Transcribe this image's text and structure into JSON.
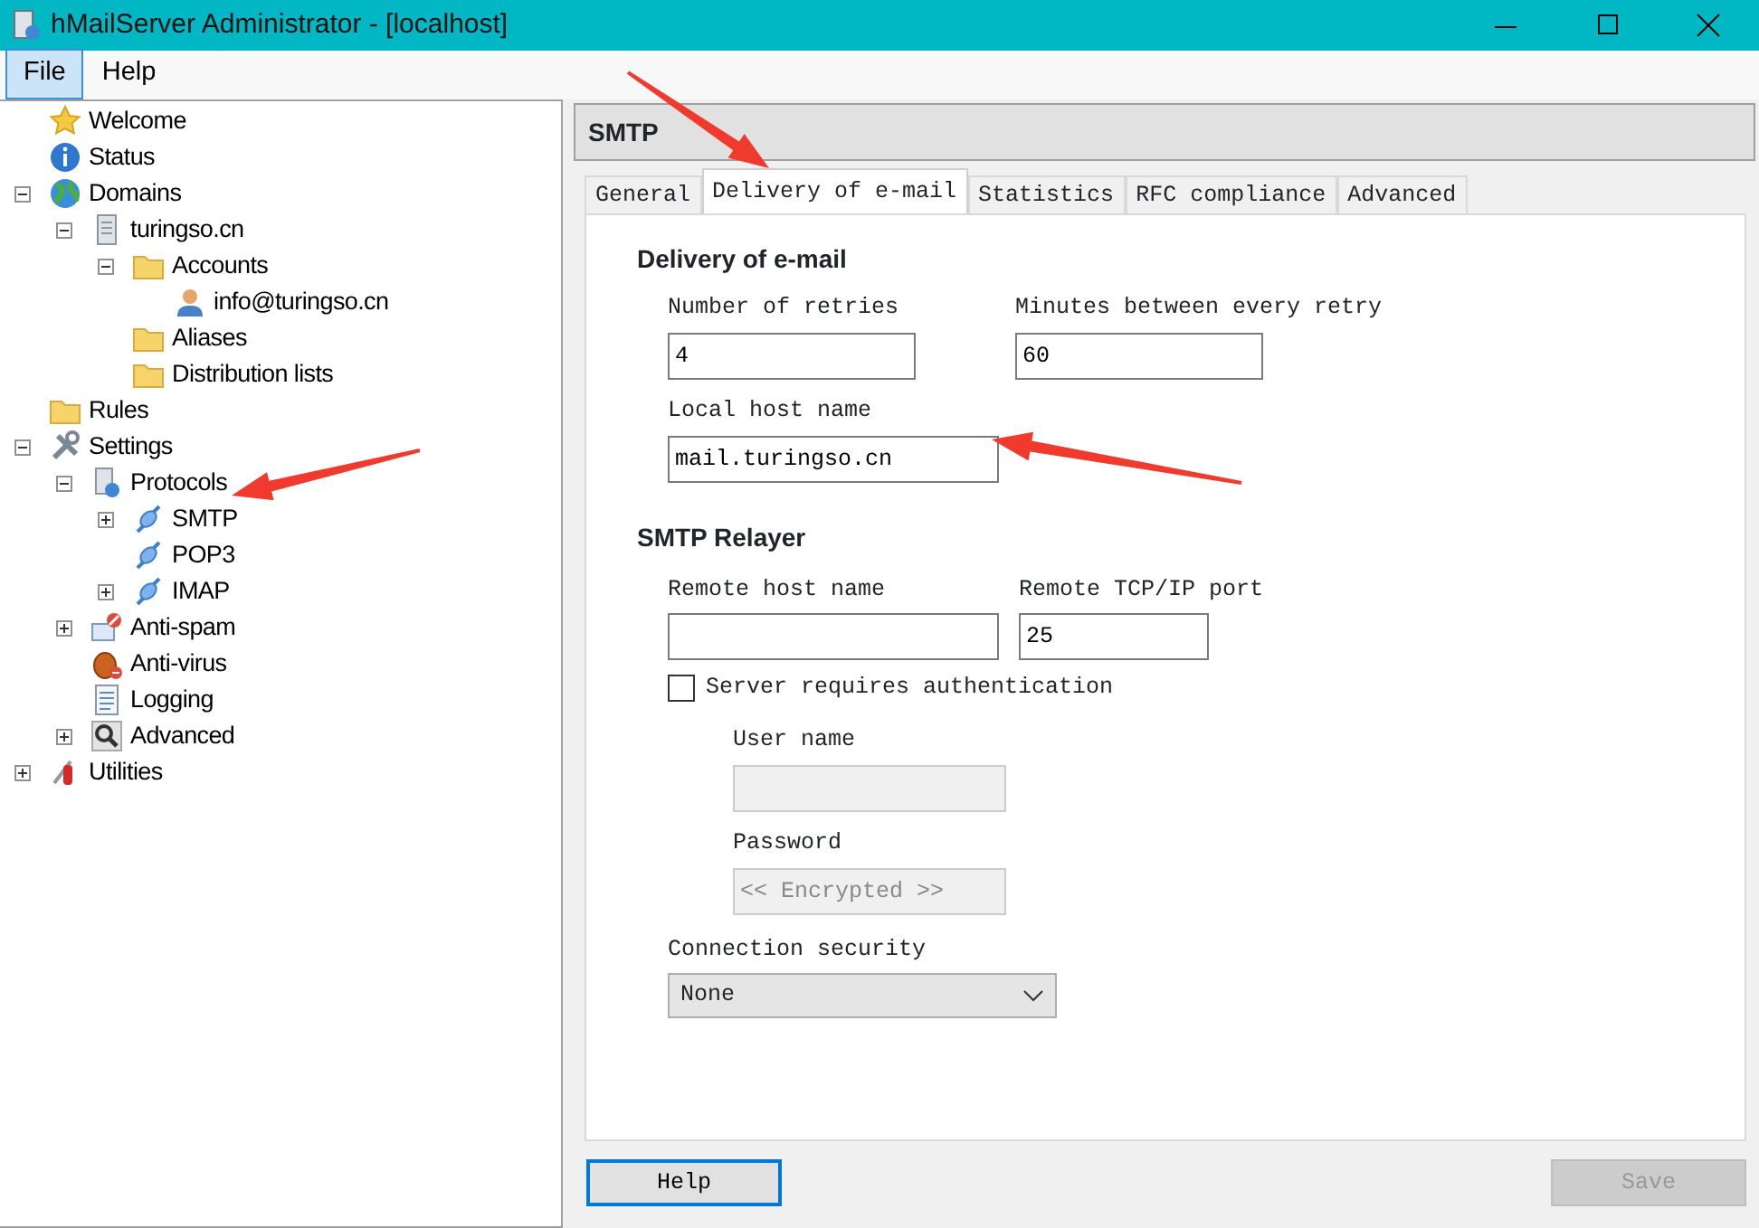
{
  "window": {
    "title": "hMailServer Administrator - [localhost]"
  },
  "menu": [
    {
      "label": "File",
      "selected": true
    },
    {
      "label": "Help",
      "selected": false
    }
  ],
  "tree": [
    {
      "label": "Welcome",
      "kind": "star"
    },
    {
      "label": "Status",
      "kind": "info"
    },
    {
      "label": "Domains",
      "kind": "globe",
      "expanded": true,
      "children": [
        {
          "label": "turingso.cn",
          "kind": "server",
          "expanded": true,
          "children": [
            {
              "label": "Accounts",
              "kind": "folder",
              "expanded": true,
              "children": [
                {
                  "label": "info@turingso.cn",
                  "kind": "user"
                }
              ]
            },
            {
              "label": "Aliases",
              "kind": "folder"
            },
            {
              "label": "Distribution lists",
              "kind": "folder"
            }
          ]
        }
      ]
    },
    {
      "label": "Rules",
      "kind": "folder"
    },
    {
      "label": "Settings",
      "kind": "tools",
      "expanded": true,
      "children": [
        {
          "label": "Protocols",
          "kind": "protocols",
          "expanded": true,
          "children": [
            {
              "label": "SMTP",
              "kind": "plug",
              "expanded": false
            },
            {
              "label": "POP3",
              "kind": "plug"
            },
            {
              "label": "IMAP",
              "kind": "plug",
              "expanded": false
            }
          ]
        },
        {
          "label": "Anti-spam",
          "kind": "antispam",
          "expanded": false
        },
        {
          "label": "Anti-virus",
          "kind": "antivirus"
        },
        {
          "label": "Logging",
          "kind": "log"
        },
        {
          "label": "Advanced",
          "kind": "magnifier",
          "expanded": false
        }
      ]
    },
    {
      "label": "Utilities",
      "kind": "knife",
      "expanded": false
    }
  ],
  "panel": {
    "title": "SMTP"
  },
  "tabs": [
    {
      "label": "General",
      "selected": false
    },
    {
      "label": "Delivery of e-mail",
      "selected": true
    },
    {
      "label": "Statistics",
      "selected": false
    },
    {
      "label": "RFC compliance",
      "selected": false
    },
    {
      "label": "Advanced",
      "selected": false
    }
  ],
  "delivery": {
    "heading": "Delivery of e-mail",
    "retries_label": "Number of retries",
    "retries": "4",
    "minutes_label": "Minutes between every retry",
    "minutes": "60",
    "host_label": "Local host name",
    "host": "mail.turingso.cn"
  },
  "relayer": {
    "heading": "SMTP Relayer",
    "remote_host_label": "Remote host name",
    "remote_port_label": "Remote TCP/IP port",
    "remote_port": "25",
    "auth_label": "Server requires authentication",
    "auth_checked": false,
    "user_label": "User name",
    "password_label": "Password",
    "password": "<< Encrypted >>",
    "security_label": "Connection security",
    "security": "None"
  },
  "buttons": [
    {
      "label": "Help",
      "kind": "help",
      "disabled": false
    },
    {
      "label": "Save",
      "kind": "save",
      "disabled": true
    }
  ]
}
